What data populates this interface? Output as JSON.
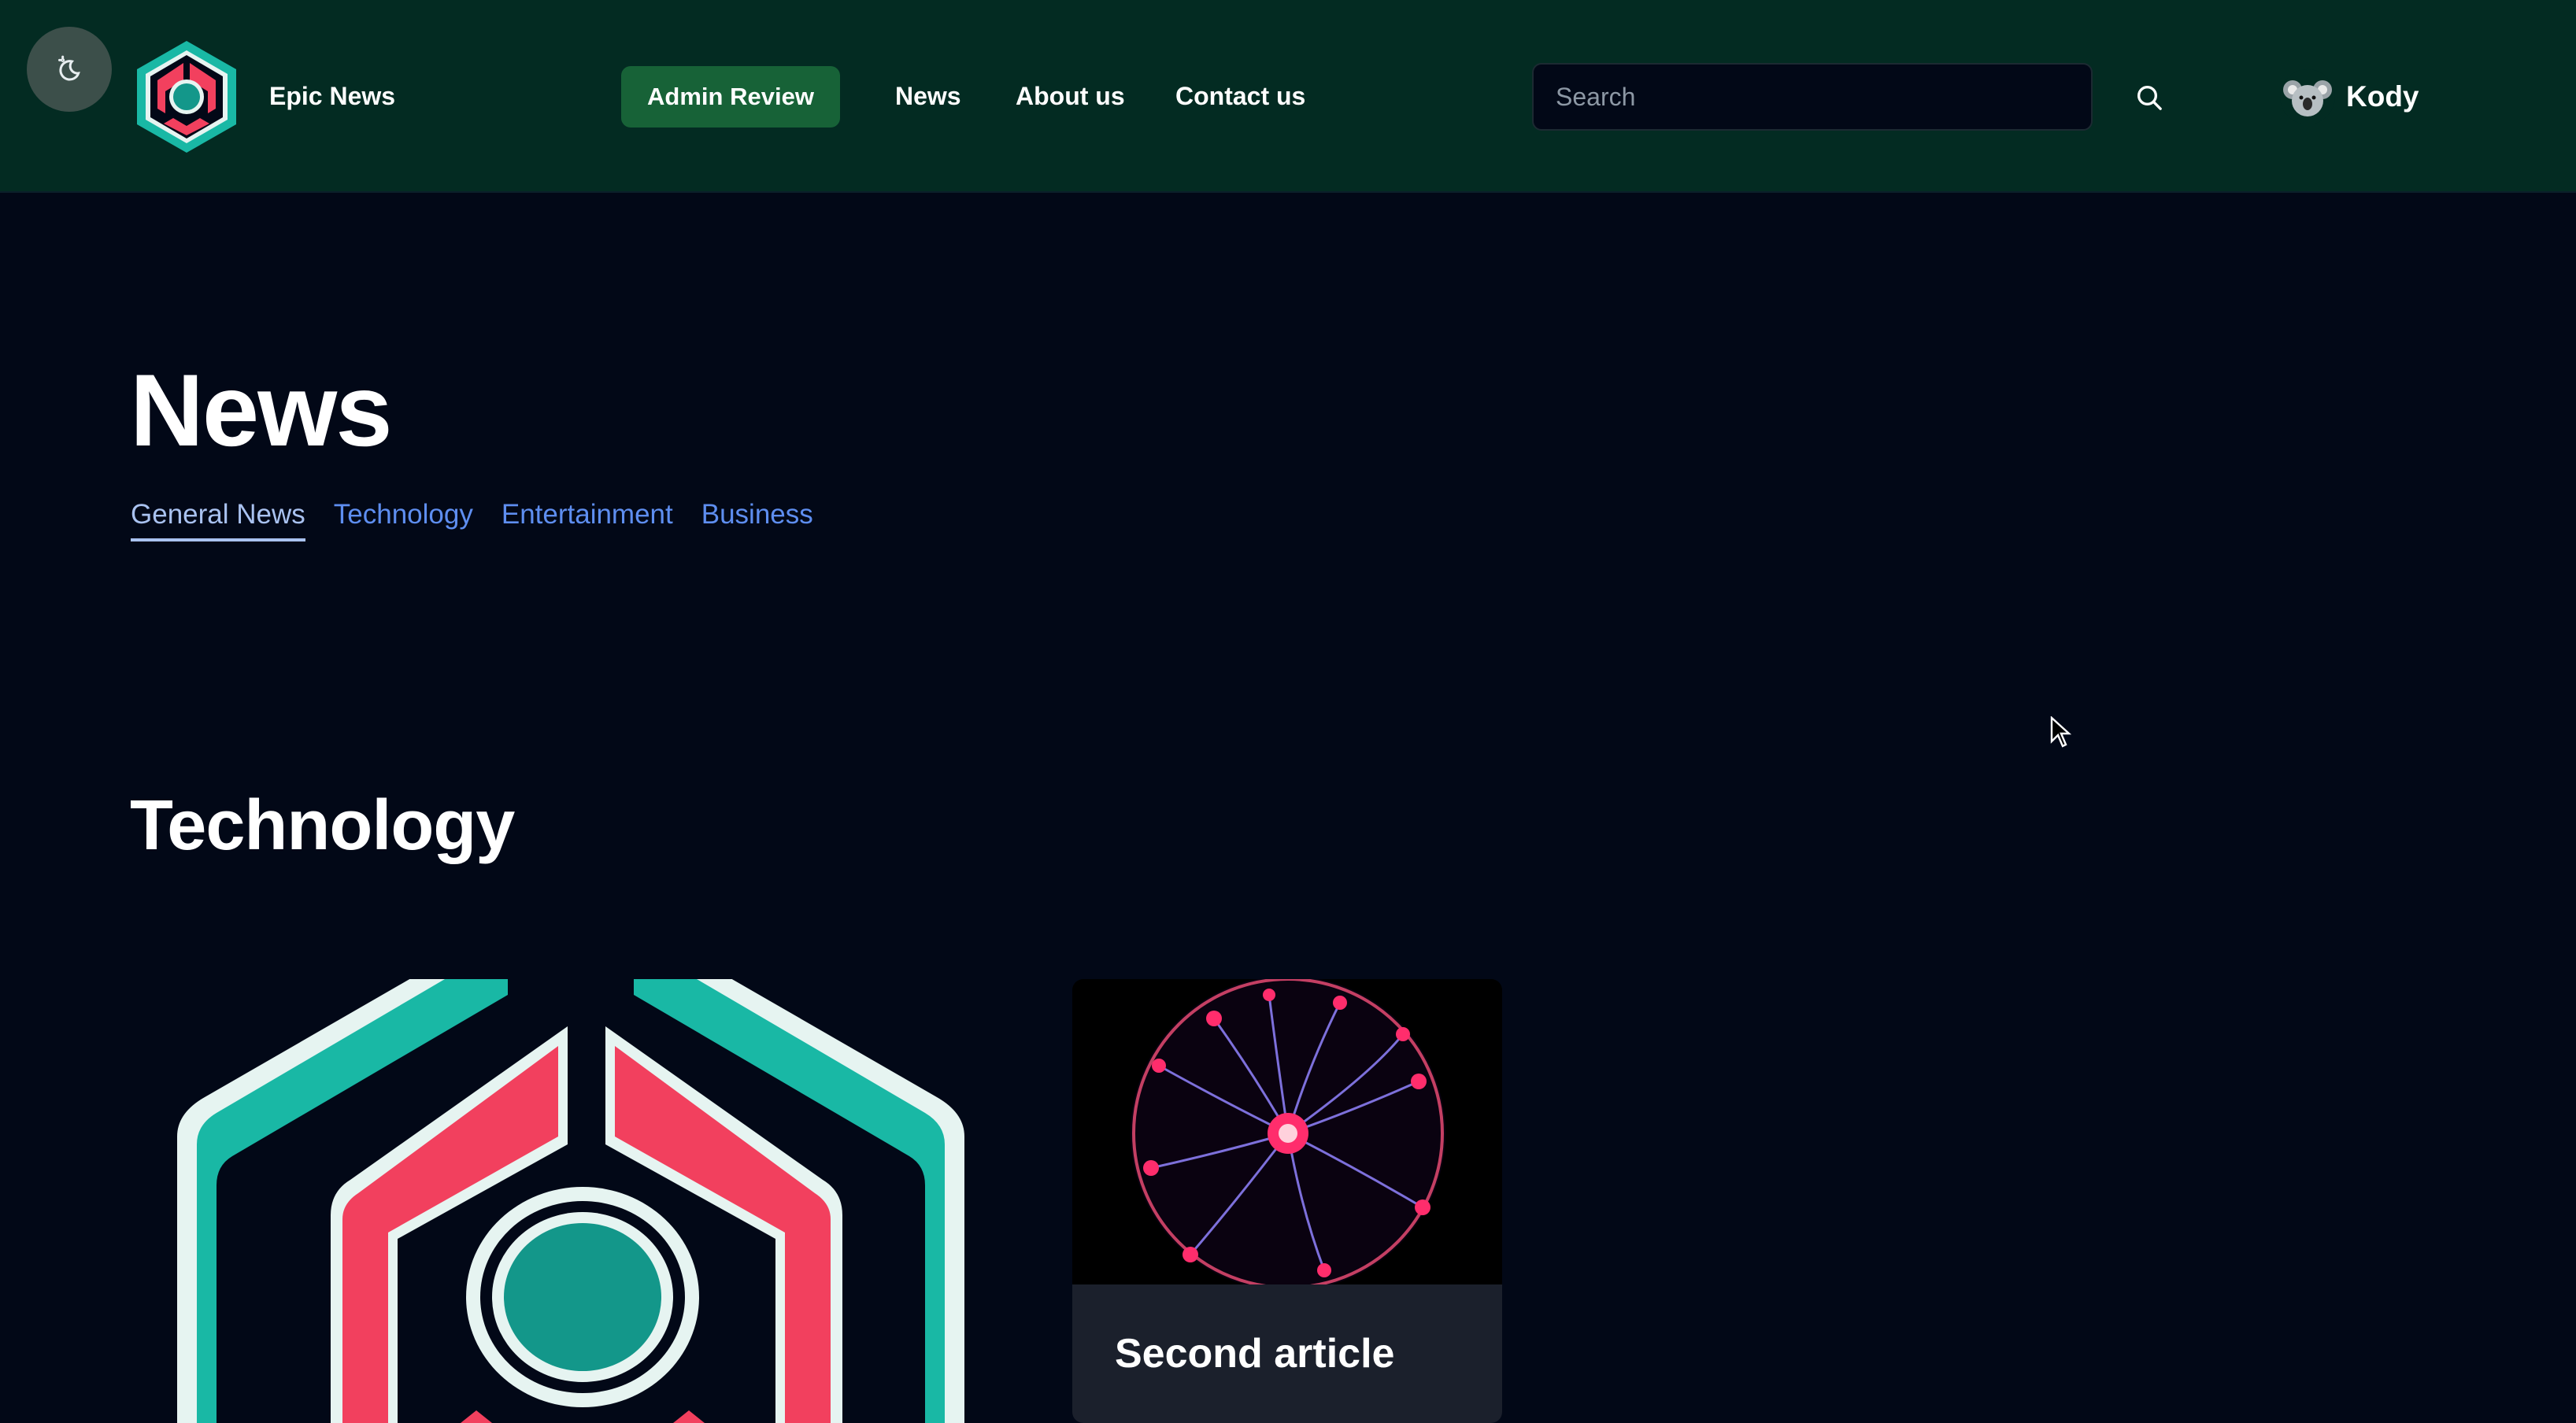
{
  "header": {
    "theme_toggle_icon": "moon-sun-icon",
    "brand": "Epic News",
    "admin_review": "Admin Review",
    "nav": [
      "News",
      "About us",
      "Contact us"
    ],
    "search": {
      "placeholder": "Search",
      "value": ""
    },
    "search_icon": "search-icon",
    "user": {
      "name": "Kody",
      "avatar_icon": "koala-avatar"
    }
  },
  "main": {
    "title": "News",
    "tabs": [
      {
        "label": "General News",
        "active": true
      },
      {
        "label": "Technology",
        "active": false
      },
      {
        "label": "Entertainment",
        "active": false
      },
      {
        "label": "Business",
        "active": false
      }
    ],
    "section_title": "Technology",
    "articles": [
      {
        "title": "",
        "image": "epic-news-logo"
      },
      {
        "title": "Second article",
        "image": "plasma-ball"
      }
    ]
  },
  "colors": {
    "header_bg": "#032b22",
    "page_bg": "#020817",
    "accent_green": "#176237",
    "teal": "#19b8a5",
    "coral": "#f2405e",
    "link_blue": "#5e8ef0"
  }
}
